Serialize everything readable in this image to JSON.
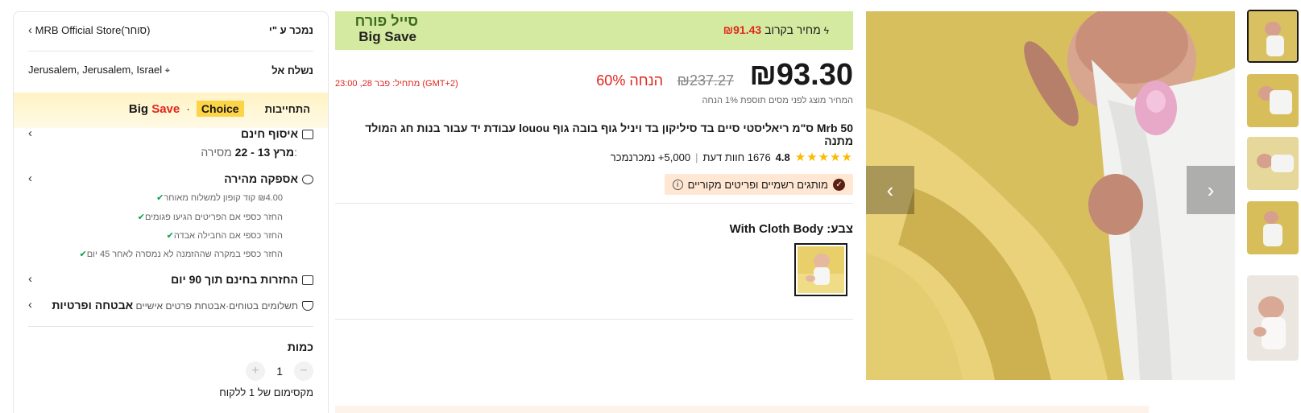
{
  "sidebar": {
    "sold_by_label": "נמכר ע \"י",
    "store_name": "MRB Official Store",
    "store_suffix": "(סוחר)",
    "ship_to_label": "נשלח אל",
    "ship_to_value": "Jerusalem, Jerusalem, Israel",
    "commitments_label": "התחייבות",
    "choice_label": "Choice",
    "dot": "·",
    "big_label": "Big ",
    "save_label": "Save",
    "pickup_title": "איסוף חינם",
    "delivery_label": "מסירה:",
    "delivery_dates": "מרץ 13 - 22",
    "fast_delivery_title": "אספקה מהירה",
    "bullets": [
      "₪4.00 קוד קופון למשלוח מאוחר",
      "החזר כספי אם הפריטים הגיעו פגומים",
      "החזר כספי אם החבילה אבדה",
      "החזר כספי במקרה שההזמנה לא נמסרה לאחר 45 יום"
    ],
    "returns_title": "החזרות בחינם תוך 90 יום",
    "security_title": "אבטחה ופרטיות",
    "security_sub": "תשלומים בטוחים·אבטחת פרטים אישיים",
    "quantity_title": "כמות",
    "quantity_value": "1",
    "minus": "−",
    "plus": "+",
    "max_note": "מקסימום של 1 ללקוח"
  },
  "banner": {
    "sale_title": "סייל פורח",
    "sale_subtitle": "Big Save",
    "flash_label": "מחיר בקרוב",
    "flash_value": "₪91.43"
  },
  "price": {
    "current": "₪93.30",
    "original": "₪237.27",
    "discount": "60% הנחה",
    "ends": "מתחיל:  פבר 28, 23:00 (GMT+2)",
    "tax_note": "המחיר מוצג לפני מסים תוספת 1% הנחה"
  },
  "product": {
    "title": "Mrb 50 ס\"מ ריאליסטי סיים בד סיליקון בד ויניל גוף בובה גוף louou עבודת יד עבור בנות חג המולד מתנה",
    "rating": "4.8",
    "reviews": "1676 חוות דעת",
    "sold": "5,000+ נמכרנמכר",
    "brand_badge": "מותגים רשמיים ופריטים מקוריים",
    "color_label": "צבע:",
    "color_value": "With Cloth Body"
  },
  "gallery": {
    "prev": "‹",
    "next": "›"
  },
  "colors": {
    "accent_red": "#e1251b",
    "choice_yellow": "#fcd446",
    "banner_green": "#d4eaa0",
    "star": "#fcb900"
  }
}
